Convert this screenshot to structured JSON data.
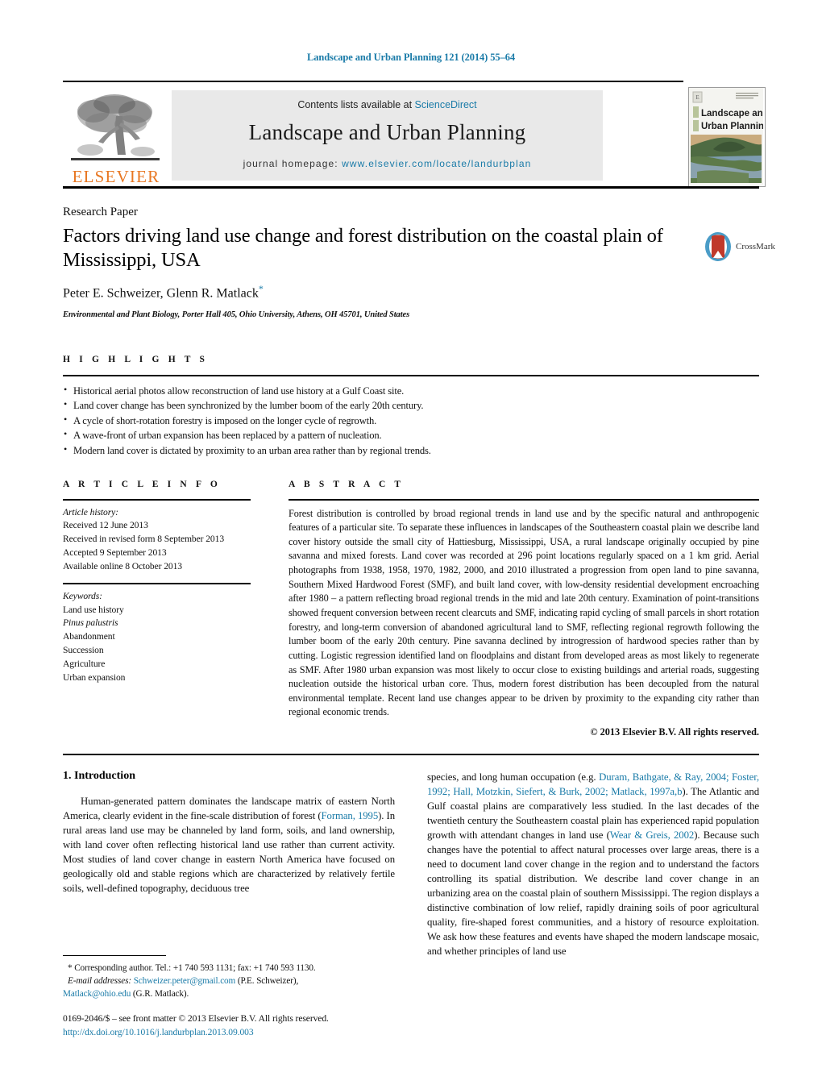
{
  "running_head": "Landscape and Urban Planning 121 (2014) 55–64",
  "header": {
    "publisher": "ELSEVIER",
    "contents_prefix": "Contents lists available at ",
    "contents_link": "ScienceDirect",
    "journal_title": "Landscape and Urban Planning",
    "homepage_prefix": "journal homepage: ",
    "homepage_url": "www.elsevier.com/locate/landurbplan",
    "cover_title_line1": "Landscape and",
    "cover_title_line2": "Urban Planning"
  },
  "article": {
    "type": "Research Paper",
    "title": "Factors driving land use change and forest distribution on the coastal plain of Mississippi, USA",
    "authors": "Peter E. Schweizer, Glenn R. Matlack",
    "author_star": "*",
    "affiliation": "Environmental and Plant Biology, Porter Hall 405, Ohio University, Athens, OH 45701, United States",
    "crossmark_label": "CrossMark"
  },
  "highlights": {
    "label": "H I G H L I G H T S",
    "items": [
      "Historical aerial photos allow reconstruction of land use history at a Gulf Coast site.",
      "Land cover change has been synchronized by the lumber boom of the early 20th century.",
      "A cycle of short-rotation forestry is imposed on the longer cycle of regrowth.",
      "A wave-front of urban expansion has been replaced by a pattern of nucleation.",
      "Modern land cover is dictated by proximity to an urban area rather than by regional trends."
    ]
  },
  "article_info": {
    "label": "A R T I C L E  I N F O",
    "history_heading": "Article history:",
    "history": [
      "Received 12 June 2013",
      "Received in revised form 8 September 2013",
      "Accepted 9 September 2013",
      "Available online 8 October 2013"
    ],
    "keywords_heading": "Keywords:",
    "keywords": [
      "Land use history",
      "Pinus palustris",
      "Abandonment",
      "Succession",
      "Agriculture",
      "Urban expansion"
    ],
    "italic_keywords": [
      "Pinus palustris"
    ]
  },
  "abstract": {
    "label": "A B S T R A C T",
    "text": "Forest distribution is controlled by broad regional trends in land use and by the specific natural and anthropogenic features of a particular site. To separate these influences in landscapes of the Southeastern coastal plain we describe land cover history outside the small city of Hattiesburg, Mississippi, USA, a rural landscape originally occupied by pine savanna and mixed forests. Land cover was recorded at 296 point locations regularly spaced on a 1 km grid. Aerial photographs from 1938, 1958, 1970, 1982, 2000, and 2010 illustrated a progression from open land to pine savanna, Southern Mixed Hardwood Forest (SMF), and built land cover, with low-density residential development encroaching after 1980 – a pattern reflecting broad regional trends in the mid and late 20th century. Examination of point-transitions showed frequent conversion between recent clearcuts and SMF, indicating rapid cycling of small parcels in short rotation forestry, and long-term conversion of abandoned agricultural land to SMF, reflecting regional regrowth following the lumber boom of the early 20th century. Pine savanna declined by introgression of hardwood species rather than by cutting. Logistic regression identified land on floodplains and distant from developed areas as most likely to regenerate as SMF. After 1980 urban expansion was most likely to occur close to existing buildings and arterial roads, suggesting nucleation outside the historical urban core. Thus, modern forest distribution has been decoupled from the natural environmental template. Recent land use changes appear to be driven by proximity to the expanding city rather than regional economic trends.",
    "copyright": "© 2013 Elsevier B.V. All rights reserved."
  },
  "introduction": {
    "heading": "1.  Introduction",
    "left_paragraph_pre": "Human-generated pattern dominates the landscape matrix of eastern North America, clearly evident in the fine-scale distribution of forest (",
    "left_citation_1": "Forman, 1995",
    "left_paragraph_post": "). In rural areas land use may be channeled by land form, soils, and land ownership, with land cover often reflecting historical land use rather than current activity. Most studies of land cover change in eastern North America have focused on geologically old and stable regions which are characterized by relatively fertile soils, well-defined topography, deciduous tree",
    "right_pre": "species, and long human occupation (e.g. ",
    "right_citation_1": "Duram, Bathgate, & Ray, 2004; Foster, 1992; Hall, Motzkin, Siefert, & Burk, 2002; Matlack, 1997a,b",
    "right_mid": "). The Atlantic and Gulf coastal plains are comparatively less studied. In the last decades of the twentieth century the Southeastern coastal plain has experienced rapid population growth with attendant changes in land use (",
    "right_citation_2": "Wear & Greis, 2002",
    "right_post": "). Because such changes have the potential to affect natural processes over large areas, there is a need to document land cover change in the region and to understand the factors controlling its spatial distribution. We describe land cover change in an urbanizing area on the coastal plain of southern Mississippi. The region displays a distinctive combination of low relief, rapidly draining soils of poor agricultural quality, fire-shaped forest communities, and a history of resource exploitation. We ask how these features and events have shaped the modern landscape mosaic, and whether principles of land use"
  },
  "footnotes": {
    "corresponding": "*  Corresponding author. Tel.: +1 740 593 1131; fax: +1 740 593 1130.",
    "email_label": "E-mail addresses:",
    "email_1": "Schweizer.peter@gmail.com",
    "email_1_owner": "(P.E. Schweizer),",
    "email_2": "Matlack@ohio.edu",
    "email_2_owner": "(G.R. Matlack).",
    "frontmatter": "0169-2046/$ – see front matter © 2013 Elsevier B.V. All rights reserved.",
    "doi": "http://dx.doi.org/10.1016/j.landurbplan.2013.09.003"
  },
  "colors": {
    "link": "#1a7ba8",
    "elsevier_orange": "#e87722",
    "header_band": "#e9e9e9"
  }
}
